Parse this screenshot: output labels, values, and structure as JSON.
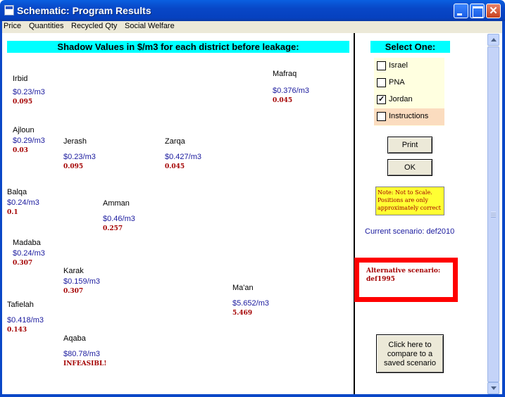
{
  "window": {
    "title": "Schematic: Program Results"
  },
  "menu": [
    "Price",
    "Quantities",
    "Recycled Qty",
    "Social Welfare"
  ],
  "main": {
    "title": "Shadow Values in $/m3 for each district before leakage:",
    "districts": [
      {
        "name": "Irbid",
        "price": "$0.23/m3",
        "value": "0.095"
      },
      {
        "name": "Mafraq",
        "price": "$0.376/m3",
        "value": "0.045"
      },
      {
        "name": "Ajloun",
        "price": "$0.29/m3",
        "value": "0.03"
      },
      {
        "name": "Jerash",
        "price": "$0.23/m3",
        "value": "0.095"
      },
      {
        "name": "Zarqa",
        "price": "$0.427/m3",
        "value": "0.045"
      },
      {
        "name": "Balqa",
        "price": "$0.24/m3",
        "value": "0.1"
      },
      {
        "name": "Amman",
        "price": "$0.46/m3",
        "value": "0.257"
      },
      {
        "name": "Madaba",
        "price": "$0.24/m3",
        "value": "0.307"
      },
      {
        "name": "Karak",
        "price": "$0.159/m3",
        "value": "0.307"
      },
      {
        "name": "Ma'an",
        "price": "$5.652/m3",
        "value": "5.469"
      },
      {
        "name": "Tafielah",
        "price": "$0.418/m3",
        "value": "0.143"
      },
      {
        "name": "Aqaba",
        "price": "$80.78/m3",
        "value": "INFEASIBL!"
      }
    ]
  },
  "panel": {
    "select_title": "Select One:",
    "options": [
      {
        "label": "Israel",
        "checked": false
      },
      {
        "label": "PNA",
        "checked": false
      },
      {
        "label": "Jordan",
        "checked": true
      },
      {
        "label": "Instructions",
        "checked": false
      }
    ],
    "print_label": "Print",
    "ok_label": "OK",
    "note": "Note: Not to Scale. Positions are only approximately correct",
    "current_scenario": "Current scenario: def2010",
    "alt_scenario_line1": "Alternative scenario:",
    "alt_scenario_line2": "def1995",
    "compare_label": "Click here to compare to a saved scenario"
  },
  "colors": {
    "header_bg": "#00ffff",
    "alt_border": "#ff0000",
    "note_bg": "#ffff33",
    "value_red": "#a40000",
    "price_blue": "#1a1a9e"
  }
}
